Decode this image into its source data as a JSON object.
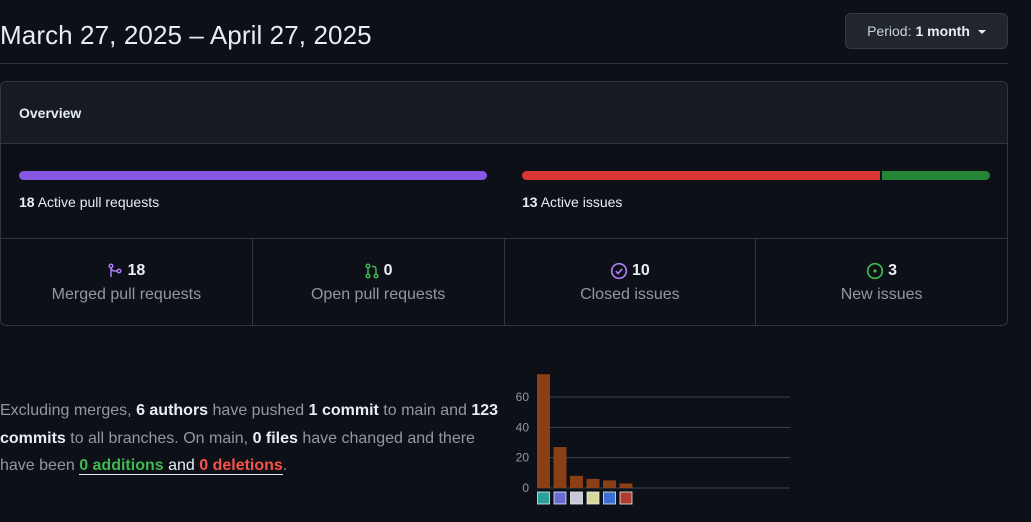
{
  "header": {
    "date_range": "March 27, 2025 – April 27, 2025",
    "period_label": "Period:",
    "period_value": "1 month"
  },
  "overview": {
    "title": "Overview",
    "pull_requests": {
      "count": "18",
      "text": "Active pull requests",
      "bar_color": "#8957e5",
      "merged_fraction": 1.0
    },
    "issues": {
      "count": "13",
      "text": "Active issues",
      "closed_color": "#da3633",
      "open_color": "#238636",
      "closed_fraction": 0.769
    },
    "stats": [
      {
        "value": "18",
        "label": "Merged pull requests",
        "icon": "git-merge-icon",
        "color": "#ab7df8"
      },
      {
        "value": "0",
        "label": "Open pull requests",
        "icon": "git-pull-request-icon",
        "color": "#3fb950"
      },
      {
        "value": "10",
        "label": "Closed issues",
        "icon": "issue-closed-icon",
        "color": "#ab7df8"
      },
      {
        "value": "3",
        "label": "New issues",
        "icon": "issue-opened-icon",
        "color": "#3fb950"
      }
    ]
  },
  "summary": {
    "t1": "Excluding merges, ",
    "authors": "6 authors",
    "t2": " have pushed ",
    "commit_main": "1 commit",
    "t3": " to main and ",
    "commits_all": "123 commits",
    "t4": " to all branches. On main, ",
    "files": "0 files",
    "t5": " have changed and there have been ",
    "additions": "0 additions",
    "t6": " and ",
    "deletions": "0 deletions",
    "t7": "."
  },
  "chart_data": {
    "type": "bar",
    "values": [
      75,
      27,
      8,
      6,
      5,
      3
    ],
    "ylim": [
      0,
      70
    ],
    "yticks": [
      "0",
      "20",
      "40",
      "60"
    ],
    "bar_color": "#8b3f16",
    "grid": true,
    "xlabel": "",
    "ylabel": ""
  }
}
